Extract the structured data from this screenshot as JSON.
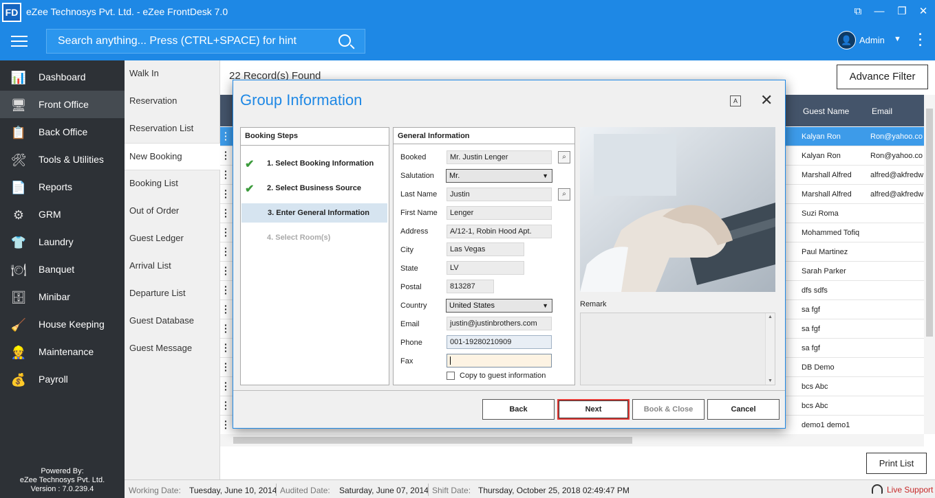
{
  "app": {
    "logo_text": "FD",
    "title": "eZee Technosys Pvt. Ltd. - eZee FrontDesk 7.0",
    "search_placeholder": "Search anything... Press (CTRL+SPACE) for hint",
    "user": {
      "name": "Admin",
      "avatar_icon": "user-icon"
    },
    "accent_color": "#1e88e5"
  },
  "sidebar": {
    "items": [
      {
        "label": "Dashboard",
        "icon": "dashboard-icon",
        "glyph": "📊"
      },
      {
        "label": "Front Office",
        "icon": "front-office-icon",
        "glyph": "🖥"
      },
      {
        "label": "Back Office",
        "icon": "back-office-icon",
        "glyph": "📋"
      },
      {
        "label": "Tools & Utilities",
        "icon": "tools-icon",
        "glyph": "🛠"
      },
      {
        "label": "Reports",
        "icon": "reports-icon",
        "glyph": "📄"
      },
      {
        "label": "GRM",
        "icon": "grm-icon",
        "glyph": "⚙"
      },
      {
        "label": "Laundry",
        "icon": "laundry-icon",
        "glyph": "👕"
      },
      {
        "label": "Banquet",
        "icon": "banquet-icon",
        "glyph": "🍽"
      },
      {
        "label": "Minibar",
        "icon": "minibar-icon",
        "glyph": "🗄"
      },
      {
        "label": "House Keeping",
        "icon": "house-keeping-icon",
        "glyph": "🧹"
      },
      {
        "label": "Maintenance",
        "icon": "maintenance-icon",
        "glyph": "👷"
      },
      {
        "label": "Payroll",
        "icon": "payroll-icon",
        "glyph": "💰"
      }
    ],
    "active": "Front Office",
    "powered_by": [
      "Powered By:",
      "eZee Technosys Pvt. Ltd.",
      "Version : 7.0.239.4"
    ]
  },
  "submenu": {
    "items": [
      "Walk In",
      "Reservation",
      "Reservation List",
      "New Booking",
      "Booking List",
      "Out of Order",
      "Guest Ledger",
      "Arrival List",
      "Departure List",
      "Guest Database",
      "Guest Message"
    ],
    "selected": "New Booking"
  },
  "main": {
    "records_found": "22 Record(s) Found",
    "advance_filter": "Advance Filter",
    "print_list": "Print List",
    "columns": [
      "Guest Name",
      "Email"
    ],
    "rows": [
      {
        "name": "Kalyan Ron",
        "email": "Ron@yahoo.co"
      },
      {
        "name": "Kalyan Ron",
        "email": "Ron@yahoo.co"
      },
      {
        "name": "Marshall Alfred",
        "email": "alfred@akfredw"
      },
      {
        "name": "Marshall Alfred",
        "email": "alfred@akfredw"
      },
      {
        "name": "Suzi Roma",
        "email": ""
      },
      {
        "name": "Mohammed Tofiq",
        "email": ""
      },
      {
        "name": "Paul Martinez",
        "email": ""
      },
      {
        "name": "Sarah Parker",
        "email": ""
      },
      {
        "name": "dfs sdfs",
        "email": ""
      },
      {
        "name": "sa fgf",
        "email": ""
      },
      {
        "name": "sa fgf",
        "email": ""
      },
      {
        "name": "sa fgf",
        "email": ""
      },
      {
        "name": "DB Demo",
        "email": ""
      },
      {
        "name": "bcs Abc",
        "email": ""
      },
      {
        "name": "bcs Abc",
        "email": ""
      },
      {
        "name": "demo1 demo1",
        "email": ""
      }
    ]
  },
  "statusbar": {
    "working_date_label": "Working Date:",
    "working_date": "Tuesday, June 10, 2014",
    "audited_date_label": "Audited Date:",
    "audited_date": "Saturday, June 07, 2014",
    "shift_date_label": "Shift Date:",
    "shift_date": "Thursday, October 25, 2018 02:49:47 PM",
    "live_support": "Live Support"
  },
  "dialog": {
    "title": "Group Information",
    "steps_header": "Booking Steps",
    "steps": [
      {
        "label": "1.  Select Booking Information",
        "state": "done"
      },
      {
        "label": "2.  Select Business Source",
        "state": "done"
      },
      {
        "label": "3.  Enter General Information",
        "state": "current"
      },
      {
        "label": "4.  Select Room(s)",
        "state": "pending"
      }
    ],
    "general_header": "General Information",
    "fields": {
      "booked": {
        "label": "Booked",
        "value": "Mr. Justin Lenger"
      },
      "salutation": {
        "label": "Salutation",
        "value": "Mr."
      },
      "last_name": {
        "label": "Last Name",
        "value": "Justin"
      },
      "first_name": {
        "label": "First Name",
        "value": "Lenger"
      },
      "address": {
        "label": "Address",
        "value": "A/12-1, Robin Hood Apt."
      },
      "city": {
        "label": "City",
        "value": "Las Vegas"
      },
      "state": {
        "label": "State",
        "value": "LV"
      },
      "postal": {
        "label": "Postal",
        "value": "813287"
      },
      "country": {
        "label": "Country",
        "value": "United States"
      },
      "email": {
        "label": "Email",
        "value": "justin@justinbrothers.com"
      },
      "phone": {
        "label": "Phone",
        "value": "001-19280210909"
      },
      "fax": {
        "label": "Fax",
        "value": ""
      }
    },
    "copy_to_guest": "Copy to guest information",
    "remark_label": "Remark",
    "buttons": {
      "back": "Back",
      "next": "Next",
      "book_close": "Book & Close",
      "cancel": "Cancel"
    },
    "next_highlight_color": "#e53935"
  }
}
